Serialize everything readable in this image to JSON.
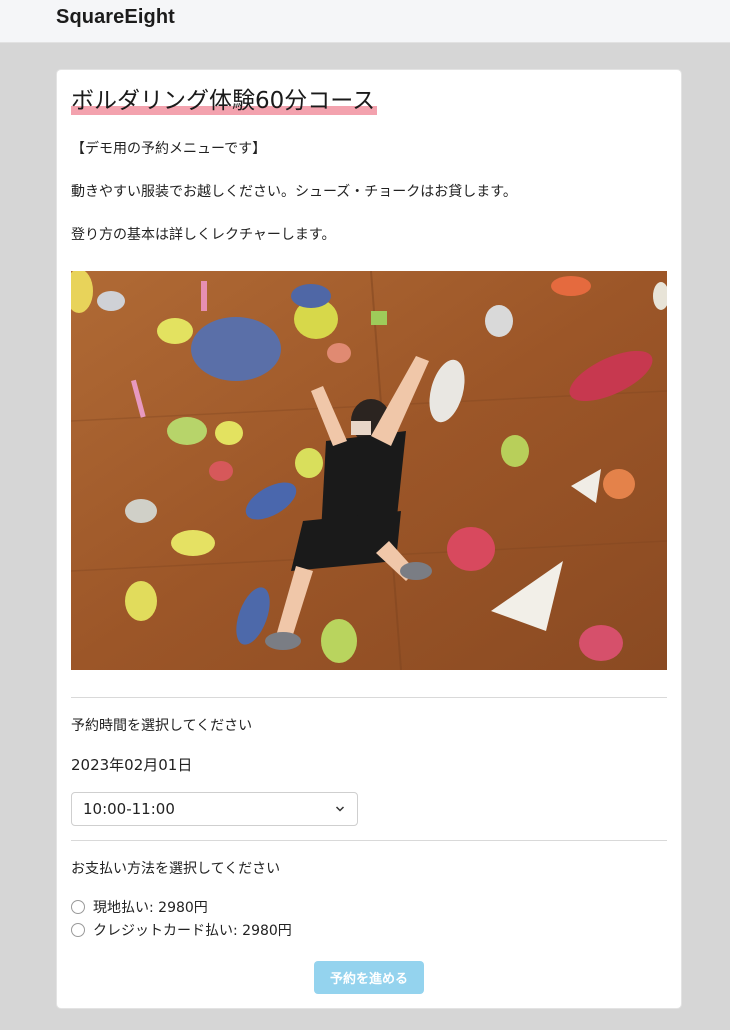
{
  "header": {
    "brand": "SquareEight"
  },
  "course": {
    "title": "ボルダリング体験60分コース",
    "description": [
      "【デモ用の予約メニューです】",
      "動きやすい服装でお越しください。シューズ・チョークはお貸します。",
      "登り方の基本は詳しくレクチャーします。"
    ],
    "photo_subject": "child-climbing-bouldering-wall"
  },
  "time_section": {
    "label": "予約時間を選択してください",
    "date": "2023年02月01日",
    "selected_time": "10:00-11:00"
  },
  "payment_section": {
    "label": "お支払い方法を選択してください",
    "options": [
      {
        "label": "現地払い: 2980円",
        "selected": false
      },
      {
        "label": "クレジットカード払い: 2980円",
        "selected": false
      }
    ]
  },
  "submit": {
    "label": "予約を進める",
    "enabled": false
  },
  "colors": {
    "accent_underline": "#f3a2ae",
    "button_disabled": "#94d3ee",
    "page_bg": "#d6d6d6"
  }
}
